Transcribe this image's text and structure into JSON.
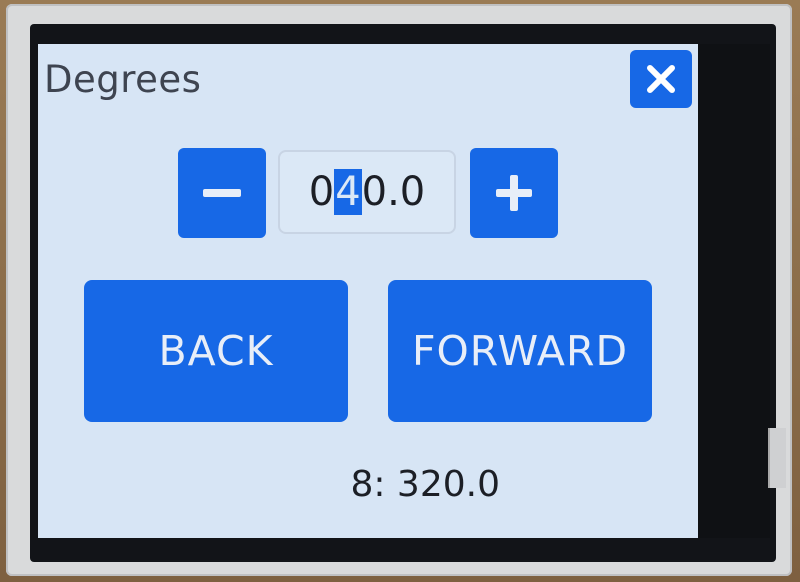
{
  "dialog": {
    "title": "Degrees",
    "close_icon": "close-icon"
  },
  "stepper": {
    "minus_icon": "minus-icon",
    "plus_icon": "plus-icon",
    "value_prefix": "0",
    "value_cursor_char": "4",
    "value_suffix": "0.0"
  },
  "actions": {
    "back_label": "BACK",
    "forward_label": "FORWARD"
  },
  "status": {
    "text": "8: 320.0"
  },
  "colors": {
    "accent": "#1768e6",
    "screen_bg": "#d7e5f5",
    "text": "#1c1f26"
  }
}
